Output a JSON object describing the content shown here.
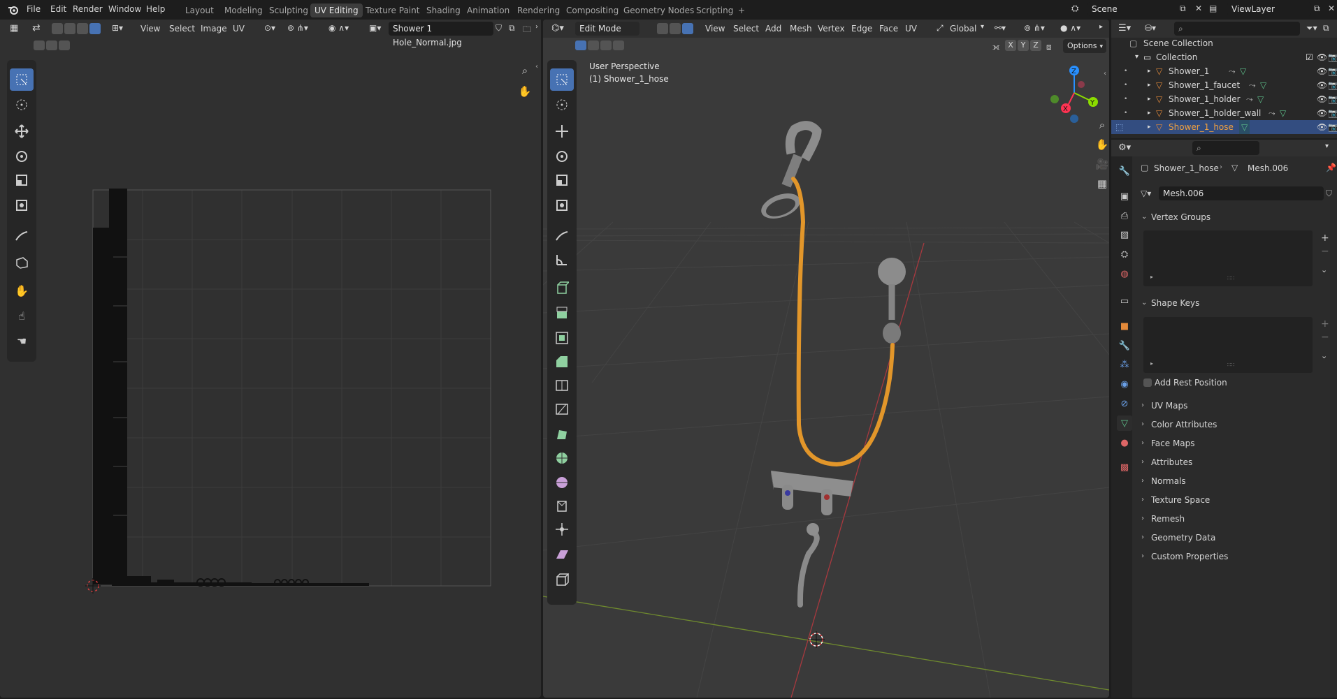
{
  "topbar": {
    "menus": [
      "File",
      "Edit",
      "Render",
      "Window",
      "Help"
    ],
    "workspaces": [
      "Layout",
      "Modeling",
      "Sculpting",
      "UV Editing",
      "Texture Paint",
      "Shading",
      "Animation",
      "Rendering",
      "Compositing",
      "Geometry Nodes",
      "Scripting"
    ],
    "active_workspace": "UV Editing",
    "add_tab": "+",
    "scene": "Scene",
    "view_layer": "ViewLayer"
  },
  "uv_editor": {
    "menus": [
      "View",
      "Select",
      "Image",
      "UV"
    ],
    "image_name": "Shower 1 Hole_Normal.jpg"
  },
  "viewport": {
    "mode": "Edit Mode",
    "menus": [
      "View",
      "Select",
      "Add",
      "Mesh",
      "Vertex",
      "Edge",
      "Face",
      "UV"
    ],
    "transform_orientation": "Global",
    "axis_x": "X",
    "axis_y": "Y",
    "axis_z": "Z",
    "options": "Options",
    "overlay_title": "User Perspective",
    "overlay_object": "(1) Shower_1_hose",
    "gizmo": {
      "x": "X",
      "y": "Y",
      "z": "Z"
    }
  },
  "outliner": {
    "root": "Scene Collection",
    "collection": "Collection",
    "items": [
      "Shower_1",
      "Shower_1_faucet",
      "Shower_1_holder",
      "Shower_1_holder_wall",
      "Shower_1_hose"
    ],
    "selected": "Shower_1_hose"
  },
  "properties": {
    "object_name": "Shower_1_hose",
    "mesh_name": "Mesh.006",
    "datablock": "Mesh.006",
    "panels_open": [
      "Vertex Groups",
      "Shape Keys"
    ],
    "add_rest_position": "Add Rest Position",
    "panels_closed": [
      "UV Maps",
      "Color Attributes",
      "Face Maps",
      "Attributes",
      "Normals",
      "Texture Space",
      "Remesh",
      "Geometry Data",
      "Custom Properties"
    ]
  },
  "colors": {
    "accent": "#4772b3",
    "selected_row": "#334d80",
    "hose": "#e2962a",
    "axis_x": "#ff3352",
    "axis_y": "#8bdc00",
    "axis_z": "#2890ff"
  }
}
